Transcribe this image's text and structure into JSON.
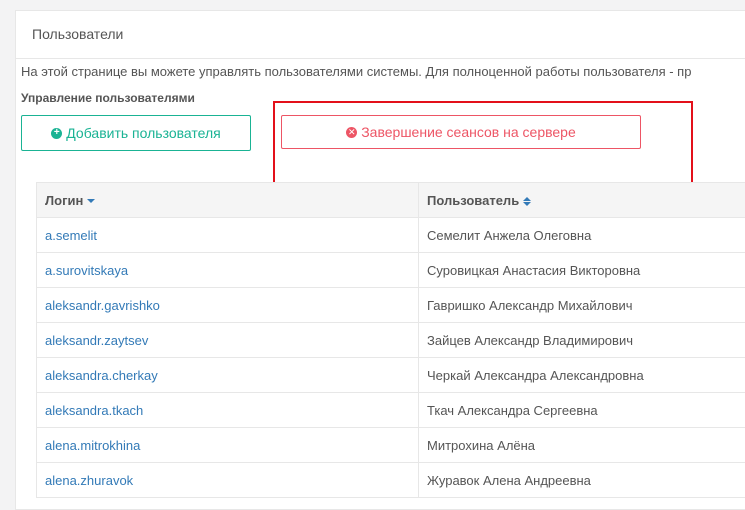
{
  "panel": {
    "title": "Пользователи"
  },
  "intro_text": "На этой странице вы можете управлять пользователями системы. Для полноценной работы пользователя - пр",
  "section_title": "Управление пользователями",
  "buttons": {
    "add_user": "Добавить пользователя",
    "end_sessions": "Завершение сеансов на сервере"
  },
  "table": {
    "headers": {
      "login": "Логин",
      "user": "Пользователь"
    },
    "rows": [
      {
        "login": "a.semelit",
        "name": "Семелит Анжела Олеговна"
      },
      {
        "login": "a.surovitskaya",
        "name": "Суровицкая Анастасия Викторовна"
      },
      {
        "login": "aleksandr.gavrishko",
        "name": "Гавришко Александр Михайлович"
      },
      {
        "login": "aleksandr.zaytsev",
        "name": "Зайцев Александр Владимирович"
      },
      {
        "login": "aleksandra.cherkay",
        "name": "Черкай Александра Александровна"
      },
      {
        "login": "aleksandra.tkach",
        "name": "Ткач Александра Сергеевна"
      },
      {
        "login": "alena.mitrokhina",
        "name": "Митрохина Алёна"
      },
      {
        "login": "alena.zhuravok",
        "name": "Журавок Алена Андреевна"
      }
    ]
  },
  "colors": {
    "accent_green": "#1ab394",
    "danger_red": "#ed5565",
    "highlight_red": "#e3101a",
    "link_blue": "#337ab7"
  }
}
